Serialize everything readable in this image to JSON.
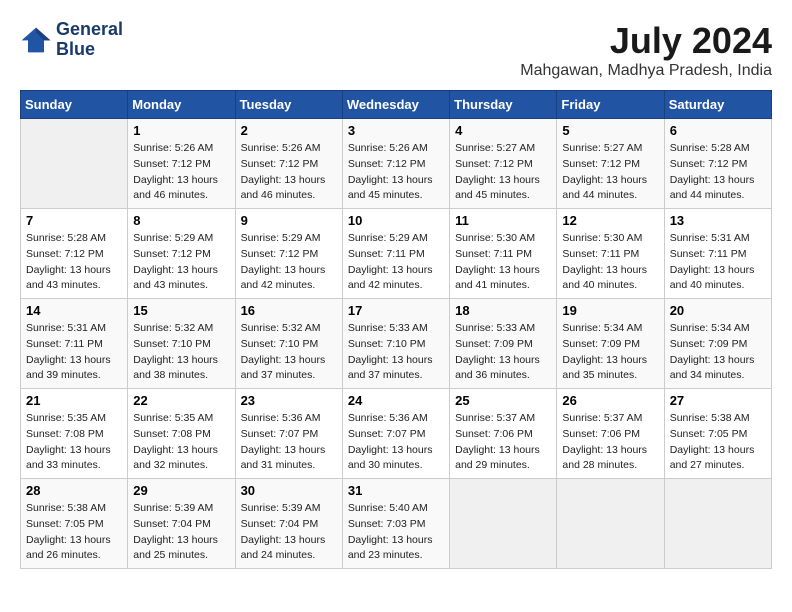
{
  "header": {
    "logo_line1": "General",
    "logo_line2": "Blue",
    "month": "July 2024",
    "location": "Mahgawan, Madhya Pradesh, India"
  },
  "weekdays": [
    "Sunday",
    "Monday",
    "Tuesday",
    "Wednesday",
    "Thursday",
    "Friday",
    "Saturday"
  ],
  "weeks": [
    [
      {
        "day": "",
        "sunrise": "",
        "sunset": "",
        "daylight": ""
      },
      {
        "day": "1",
        "sunrise": "Sunrise: 5:26 AM",
        "sunset": "Sunset: 7:12 PM",
        "daylight": "Daylight: 13 hours and 46 minutes."
      },
      {
        "day": "2",
        "sunrise": "Sunrise: 5:26 AM",
        "sunset": "Sunset: 7:12 PM",
        "daylight": "Daylight: 13 hours and 46 minutes."
      },
      {
        "day": "3",
        "sunrise": "Sunrise: 5:26 AM",
        "sunset": "Sunset: 7:12 PM",
        "daylight": "Daylight: 13 hours and 45 minutes."
      },
      {
        "day": "4",
        "sunrise": "Sunrise: 5:27 AM",
        "sunset": "Sunset: 7:12 PM",
        "daylight": "Daylight: 13 hours and 45 minutes."
      },
      {
        "day": "5",
        "sunrise": "Sunrise: 5:27 AM",
        "sunset": "Sunset: 7:12 PM",
        "daylight": "Daylight: 13 hours and 44 minutes."
      },
      {
        "day": "6",
        "sunrise": "Sunrise: 5:28 AM",
        "sunset": "Sunset: 7:12 PM",
        "daylight": "Daylight: 13 hours and 44 minutes."
      }
    ],
    [
      {
        "day": "7",
        "sunrise": "Sunrise: 5:28 AM",
        "sunset": "Sunset: 7:12 PM",
        "daylight": "Daylight: 13 hours and 43 minutes."
      },
      {
        "day": "8",
        "sunrise": "Sunrise: 5:29 AM",
        "sunset": "Sunset: 7:12 PM",
        "daylight": "Daylight: 13 hours and 43 minutes."
      },
      {
        "day": "9",
        "sunrise": "Sunrise: 5:29 AM",
        "sunset": "Sunset: 7:12 PM",
        "daylight": "Daylight: 13 hours and 42 minutes."
      },
      {
        "day": "10",
        "sunrise": "Sunrise: 5:29 AM",
        "sunset": "Sunset: 7:11 PM",
        "daylight": "Daylight: 13 hours and 42 minutes."
      },
      {
        "day": "11",
        "sunrise": "Sunrise: 5:30 AM",
        "sunset": "Sunset: 7:11 PM",
        "daylight": "Daylight: 13 hours and 41 minutes."
      },
      {
        "day": "12",
        "sunrise": "Sunrise: 5:30 AM",
        "sunset": "Sunset: 7:11 PM",
        "daylight": "Daylight: 13 hours and 40 minutes."
      },
      {
        "day": "13",
        "sunrise": "Sunrise: 5:31 AM",
        "sunset": "Sunset: 7:11 PM",
        "daylight": "Daylight: 13 hours and 40 minutes."
      }
    ],
    [
      {
        "day": "14",
        "sunrise": "Sunrise: 5:31 AM",
        "sunset": "Sunset: 7:11 PM",
        "daylight": "Daylight: 13 hours and 39 minutes."
      },
      {
        "day": "15",
        "sunrise": "Sunrise: 5:32 AM",
        "sunset": "Sunset: 7:10 PM",
        "daylight": "Daylight: 13 hours and 38 minutes."
      },
      {
        "day": "16",
        "sunrise": "Sunrise: 5:32 AM",
        "sunset": "Sunset: 7:10 PM",
        "daylight": "Daylight: 13 hours and 37 minutes."
      },
      {
        "day": "17",
        "sunrise": "Sunrise: 5:33 AM",
        "sunset": "Sunset: 7:10 PM",
        "daylight": "Daylight: 13 hours and 37 minutes."
      },
      {
        "day": "18",
        "sunrise": "Sunrise: 5:33 AM",
        "sunset": "Sunset: 7:09 PM",
        "daylight": "Daylight: 13 hours and 36 minutes."
      },
      {
        "day": "19",
        "sunrise": "Sunrise: 5:34 AM",
        "sunset": "Sunset: 7:09 PM",
        "daylight": "Daylight: 13 hours and 35 minutes."
      },
      {
        "day": "20",
        "sunrise": "Sunrise: 5:34 AM",
        "sunset": "Sunset: 7:09 PM",
        "daylight": "Daylight: 13 hours and 34 minutes."
      }
    ],
    [
      {
        "day": "21",
        "sunrise": "Sunrise: 5:35 AM",
        "sunset": "Sunset: 7:08 PM",
        "daylight": "Daylight: 13 hours and 33 minutes."
      },
      {
        "day": "22",
        "sunrise": "Sunrise: 5:35 AM",
        "sunset": "Sunset: 7:08 PM",
        "daylight": "Daylight: 13 hours and 32 minutes."
      },
      {
        "day": "23",
        "sunrise": "Sunrise: 5:36 AM",
        "sunset": "Sunset: 7:07 PM",
        "daylight": "Daylight: 13 hours and 31 minutes."
      },
      {
        "day": "24",
        "sunrise": "Sunrise: 5:36 AM",
        "sunset": "Sunset: 7:07 PM",
        "daylight": "Daylight: 13 hours and 30 minutes."
      },
      {
        "day": "25",
        "sunrise": "Sunrise: 5:37 AM",
        "sunset": "Sunset: 7:06 PM",
        "daylight": "Daylight: 13 hours and 29 minutes."
      },
      {
        "day": "26",
        "sunrise": "Sunrise: 5:37 AM",
        "sunset": "Sunset: 7:06 PM",
        "daylight": "Daylight: 13 hours and 28 minutes."
      },
      {
        "day": "27",
        "sunrise": "Sunrise: 5:38 AM",
        "sunset": "Sunset: 7:05 PM",
        "daylight": "Daylight: 13 hours and 27 minutes."
      }
    ],
    [
      {
        "day": "28",
        "sunrise": "Sunrise: 5:38 AM",
        "sunset": "Sunset: 7:05 PM",
        "daylight": "Daylight: 13 hours and 26 minutes."
      },
      {
        "day": "29",
        "sunrise": "Sunrise: 5:39 AM",
        "sunset": "Sunset: 7:04 PM",
        "daylight": "Daylight: 13 hours and 25 minutes."
      },
      {
        "day": "30",
        "sunrise": "Sunrise: 5:39 AM",
        "sunset": "Sunset: 7:04 PM",
        "daylight": "Daylight: 13 hours and 24 minutes."
      },
      {
        "day": "31",
        "sunrise": "Sunrise: 5:40 AM",
        "sunset": "Sunset: 7:03 PM",
        "daylight": "Daylight: 13 hours and 23 minutes."
      },
      {
        "day": "",
        "sunrise": "",
        "sunset": "",
        "daylight": ""
      },
      {
        "day": "",
        "sunrise": "",
        "sunset": "",
        "daylight": ""
      },
      {
        "day": "",
        "sunrise": "",
        "sunset": "",
        "daylight": ""
      }
    ]
  ]
}
